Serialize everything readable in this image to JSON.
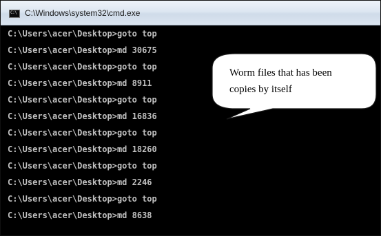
{
  "window": {
    "title": "C:\\Windows\\system32\\cmd.exe",
    "icon": "cmd-icon",
    "icon_glyph": "C:\\"
  },
  "console": {
    "lines": [
      "C:\\Users\\acer\\Desktop>goto top",
      "C:\\Users\\acer\\Desktop>md 30675",
      "C:\\Users\\acer\\Desktop>goto top",
      "C:\\Users\\acer\\Desktop>md 8911",
      "C:\\Users\\acer\\Desktop>goto top",
      "C:\\Users\\acer\\Desktop>md 16836",
      "C:\\Users\\acer\\Desktop>goto top",
      "C:\\Users\\acer\\Desktop>md 18260",
      "C:\\Users\\acer\\Desktop>goto top",
      "C:\\Users\\acer\\Desktop>md 2246",
      "C:\\Users\\acer\\Desktop>goto top",
      "C:\\Users\\acer\\Desktop>md 8638"
    ]
  },
  "callout": {
    "lines": [
      "Worm files that has been",
      "copies by itself"
    ]
  },
  "colors": {
    "console_background": "#000000",
    "console_text": "#c0c0c0"
  }
}
